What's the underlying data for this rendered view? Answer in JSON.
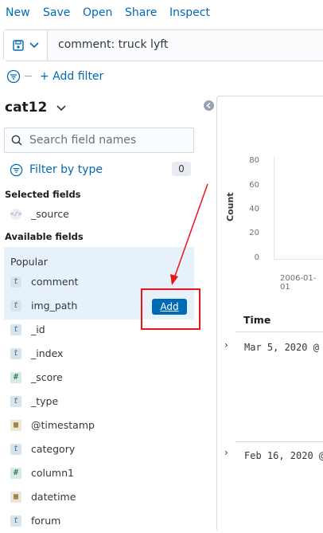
{
  "top_menu": {
    "new": "New",
    "save": "Save",
    "open": "Open",
    "share": "Share",
    "inspect": "Inspect"
  },
  "query": {
    "value": "comment: truck lyft"
  },
  "filter": {
    "add_filter": "+ Add filter"
  },
  "sidebar": {
    "index_pattern": "cat12",
    "search_placeholder": "Search field names",
    "filter_by_type": "Filter by type",
    "filter_count": "0",
    "selected_heading": "Selected fields",
    "selected_fields": [
      {
        "name": "_source",
        "type_icon": "source-icon"
      }
    ],
    "available_heading": "Available fields",
    "popular_heading": "Popular",
    "popular_fields": [
      {
        "name": "comment",
        "type_icon": "string-type-icon",
        "glyph": "t"
      },
      {
        "name": "img_path",
        "type_icon": "string-type-icon",
        "glyph": "t"
      }
    ],
    "fields": [
      {
        "name": "_id",
        "type_icon": "string-type-icon",
        "glyph": "t"
      },
      {
        "name": "_index",
        "type_icon": "string-type-icon",
        "glyph": "t"
      },
      {
        "name": "_score",
        "type_icon": "number-type-icon",
        "glyph": "#"
      },
      {
        "name": "_type",
        "type_icon": "string-type-icon",
        "glyph": "t"
      },
      {
        "name": "@timestamp",
        "type_icon": "date-type-icon",
        "glyph": "▦"
      },
      {
        "name": "category",
        "type_icon": "string-type-icon",
        "glyph": "t"
      },
      {
        "name": "column1",
        "type_icon": "number-type-icon",
        "glyph": "#"
      },
      {
        "name": "datetime",
        "type_icon": "date-type-icon",
        "glyph": "▦"
      },
      {
        "name": "forum",
        "type_icon": "string-type-icon",
        "glyph": "t"
      }
    ],
    "add_button": "Add"
  },
  "chart_data": {
    "type": "bar",
    "ylabel": "Count",
    "yticks": [
      "80",
      "60",
      "40",
      "20",
      "0"
    ],
    "ylim": [
      0,
      80
    ],
    "x_tick_labels": [
      "2006-01-01"
    ]
  },
  "results": {
    "time_header": "Time",
    "rows": [
      {
        "time": "Mar 5, 2020 @"
      },
      {
        "time": "Feb 16, 2020 @"
      }
    ]
  },
  "colors": {
    "link": "#006bb4",
    "annotation_red": "#e8141c",
    "popular_bg": "#e6f1fa"
  }
}
